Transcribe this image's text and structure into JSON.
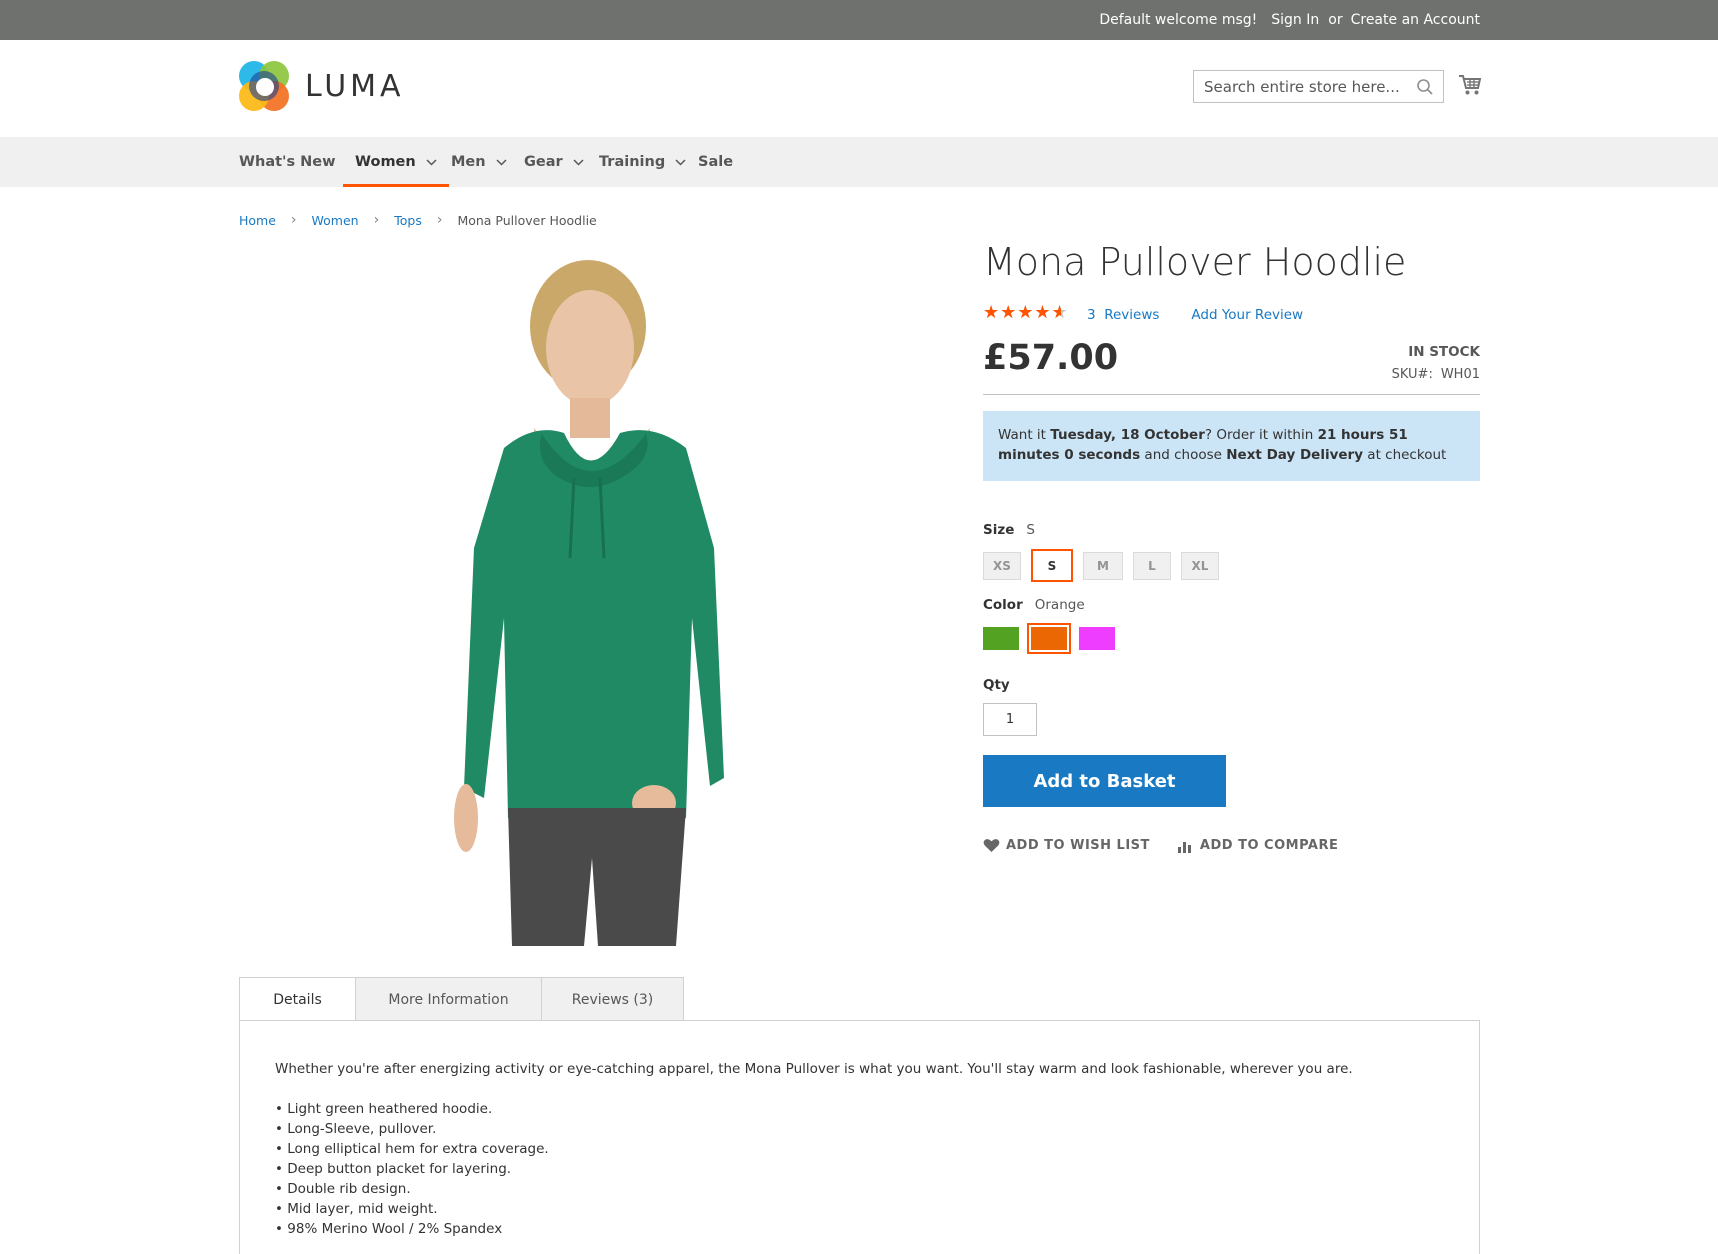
{
  "header": {
    "welcome": "Default welcome msg!",
    "sign_in": "Sign In",
    "or": "or",
    "create_account": "Create an Account",
    "logo_text": "LUMA",
    "search_placeholder": "Search entire store here..."
  },
  "nav": {
    "items": [
      {
        "label": "What's New",
        "has_dropdown": false
      },
      {
        "label": "Women",
        "has_dropdown": true,
        "active": true
      },
      {
        "label": "Men",
        "has_dropdown": true
      },
      {
        "label": "Gear",
        "has_dropdown": true
      },
      {
        "label": "Training",
        "has_dropdown": true
      },
      {
        "label": "Sale",
        "has_dropdown": false
      }
    ]
  },
  "breadcrumbs": [
    "Home",
    "Women",
    "Tops",
    "Mona Pullover Hoodlie"
  ],
  "product": {
    "title": "Mona Pullover Hoodlie",
    "rating_fraction": 0.87,
    "reviews_count": "3",
    "reviews_label": "Reviews",
    "add_review": "Add Your Review",
    "price": "£57.00",
    "stock": "IN STOCK",
    "sku_label": "SKU#:",
    "sku": "WH01"
  },
  "delivery": {
    "t1": "Want it ",
    "date": "Tuesday, 18 October",
    "t2": "? Order it within ",
    "countdown": "21 hours 51 minutes 0 seconds",
    "t3": " and choose ",
    "method": "Next Day Delivery",
    "t4": " at checkout"
  },
  "options": {
    "size_label": "Size",
    "size_selected": "S",
    "sizes": [
      "XS",
      "S",
      "M",
      "L",
      "XL"
    ],
    "color_label": "Color",
    "color_selected": "Orange",
    "colors": [
      {
        "name": "Green",
        "hex": "#53a221"
      },
      {
        "name": "Orange",
        "hex": "#eb6703"
      },
      {
        "name": "Purple",
        "hex": "#ef3dff"
      }
    ],
    "qty_label": "Qty",
    "qty_value": "1"
  },
  "buttons": {
    "add_to_basket": "Add to Basket",
    "wish_list": "ADD TO WISH LIST",
    "compare": "ADD TO COMPARE"
  },
  "tabs": [
    {
      "label": "Details",
      "active": true
    },
    {
      "label": "More Information"
    },
    {
      "label": "Reviews (3)"
    }
  ],
  "details": {
    "intro": "Whether you're after energizing activity or eye-catching apparel, the Mona Pullover is what you want. You'll stay warm and look fashionable, wherever you are.",
    "bullets": [
      "Light green heathered hoodie.",
      "Long-Sleeve, pullover.",
      "Long elliptical hem for extra coverage.",
      "Deep button placket for layering.",
      "Double rib design.",
      "Mid layer, mid weight.",
      "98% Merino Wool / 2% Spandex"
    ]
  },
  "colors": {
    "accent": "#ff5501",
    "link": "#1979c3",
    "top_panel": "#6e716e",
    "nav_bg": "#f0f0f0",
    "notice_bg": "#cce5f6"
  }
}
